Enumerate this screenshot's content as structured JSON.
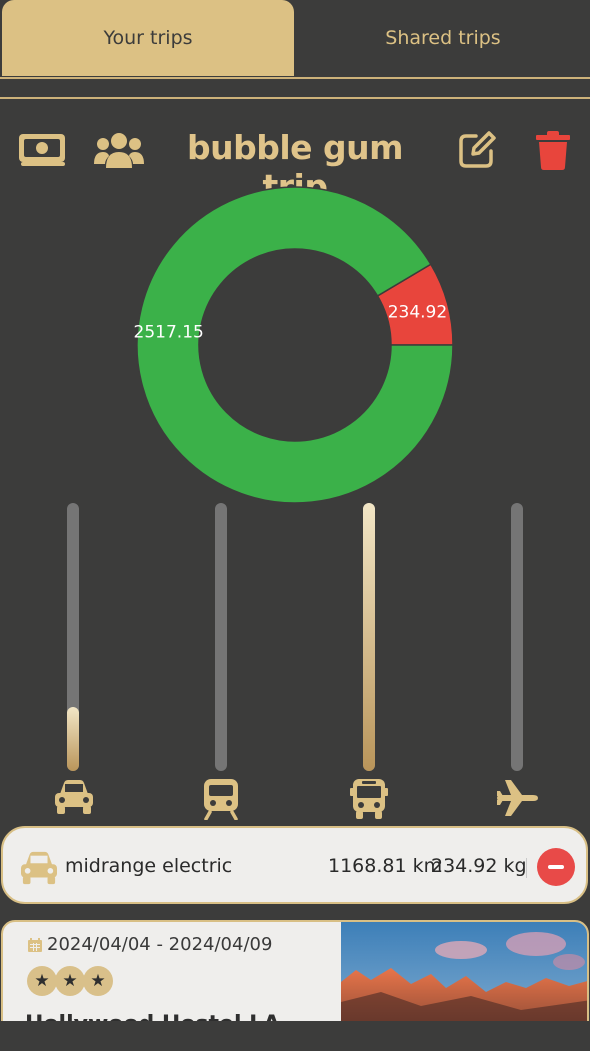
{
  "tabs": {
    "your_trips": "Your trips",
    "shared_trips": "Shared trips"
  },
  "trip": {
    "title": "bubble gum trip"
  },
  "chart_data": {
    "type": "pie",
    "donut": true,
    "categories": [
      "",
      ""
    ],
    "values": [
      2517.15,
      234.92
    ],
    "labels": [
      "2517.15",
      "234.92"
    ],
    "colors": [
      "#3bb149",
      "#e8453c"
    ]
  },
  "transport_levels": [
    {
      "mode": "car-icon",
      "level": 0.24
    },
    {
      "mode": "train-icon",
      "level": 0.0
    },
    {
      "mode": "bus-icon",
      "level": 1.0
    },
    {
      "mode": "plane-icon",
      "level": 0.0
    }
  ],
  "vehicle": {
    "name": "midrange electric",
    "distance": "1168.81 km",
    "emissions": "234.92 kg"
  },
  "hotel": {
    "dates": "2024/04/04 - 2024/04/09",
    "stars": 3,
    "name": "Hollywood Hostel LA"
  },
  "colors": {
    "accent": "#dcc184",
    "background": "#3c3c3b",
    "delete": "#e8453c",
    "green": "#3bb149"
  }
}
